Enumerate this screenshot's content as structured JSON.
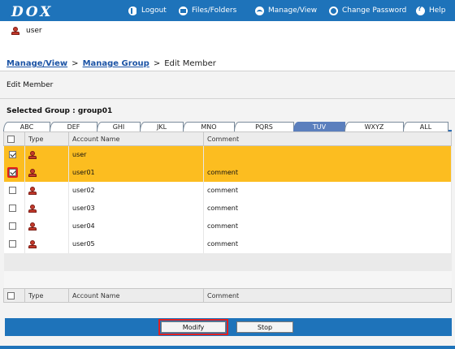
{
  "app": {
    "logo": "DOX"
  },
  "nav": {
    "logout": "Logout",
    "files": "Files/Folders",
    "manage": "Manage/View",
    "password": "Change Password",
    "help": "Help"
  },
  "current_user": "user",
  "breadcrumb": {
    "item1": "Manage/View",
    "item2": "Manage Group",
    "current": "Edit Member",
    "separator": ">"
  },
  "section_title": "Edit Member",
  "selected_group": "Selected Group : group01",
  "tabs": [
    "ABC",
    "DEF",
    "GHI",
    "JKL",
    "MNO",
    "PQRS",
    "TUV",
    "WXYZ",
    "ALL"
  ],
  "active_tab": "TUV",
  "table": {
    "headers": {
      "type": "Type",
      "account": "Account Name",
      "comment": "Comment"
    },
    "rows": [
      {
        "account": "user",
        "comment": "",
        "checked": true
      },
      {
        "account": "user01",
        "comment": "comment",
        "checked": true
      },
      {
        "account": "user02",
        "comment": "comment",
        "checked": false
      },
      {
        "account": "user03",
        "comment": "comment",
        "checked": false
      },
      {
        "account": "user04",
        "comment": "comment",
        "checked": false
      },
      {
        "account": "user05",
        "comment": "comment",
        "checked": false
      }
    ]
  },
  "buttons": {
    "modify": "Modify",
    "stop": "Stop"
  },
  "colors": {
    "accent": "#1e73ba",
    "selected_row": "#fcbd20",
    "active_tab": "#5b7fbd",
    "highlight": "#e02020"
  }
}
